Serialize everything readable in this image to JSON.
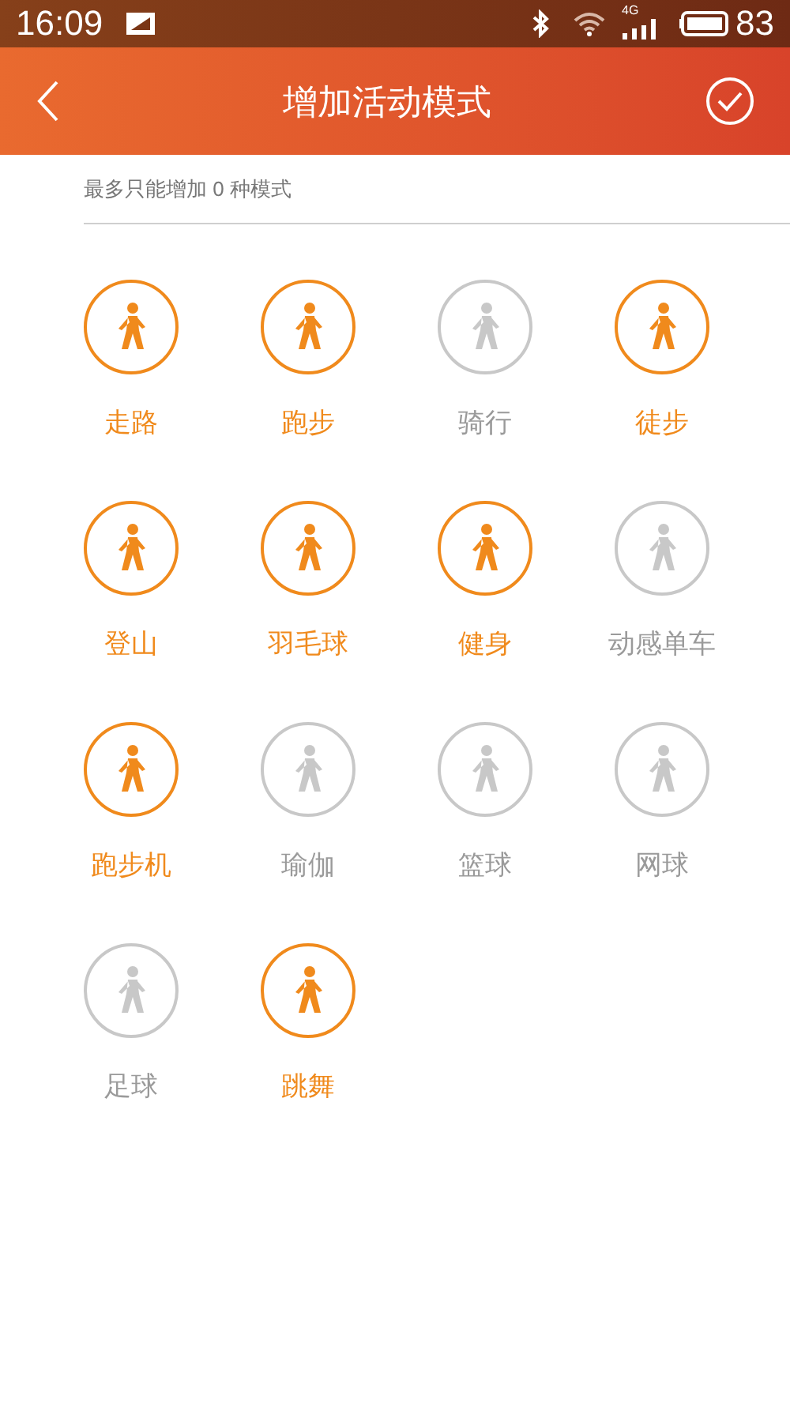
{
  "status_bar": {
    "time": "16:09",
    "network": "4G",
    "battery": "83"
  },
  "header": {
    "title": "增加活动模式"
  },
  "hint": "最多只能增加 0 种模式",
  "activities": [
    {
      "label": "走路",
      "selected": true
    },
    {
      "label": "跑步",
      "selected": true
    },
    {
      "label": "骑行",
      "selected": false
    },
    {
      "label": "徒步",
      "selected": true
    },
    {
      "label": "登山",
      "selected": true
    },
    {
      "label": "羽毛球",
      "selected": true
    },
    {
      "label": "健身",
      "selected": true
    },
    {
      "label": "动感单车",
      "selected": false
    },
    {
      "label": "跑步机",
      "selected": true
    },
    {
      "label": "瑜伽",
      "selected": false
    },
    {
      "label": "篮球",
      "selected": false
    },
    {
      "label": "网球",
      "selected": false
    },
    {
      "label": "足球",
      "selected": false
    },
    {
      "label": "跳舞",
      "selected": true
    }
  ]
}
